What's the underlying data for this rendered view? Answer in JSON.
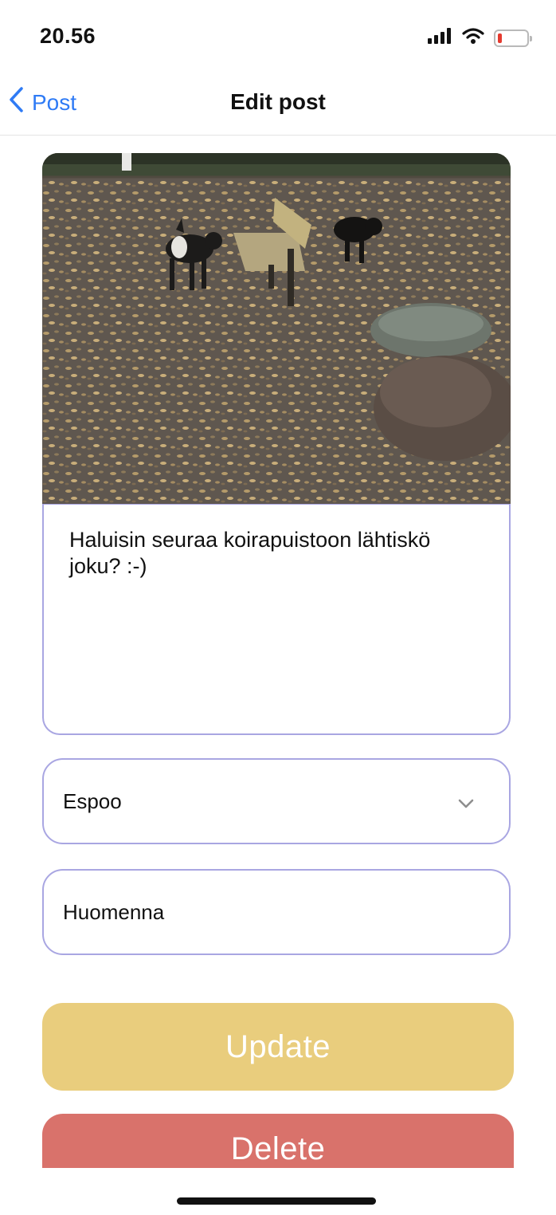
{
  "status_bar": {
    "time": "20.56",
    "icons": [
      "signal-icon",
      "wifi-icon",
      "battery-icon"
    ],
    "battery_color": "#e53a2f"
  },
  "nav": {
    "back_label": "Post",
    "title": "Edit post",
    "accent_color": "#2f7bf5"
  },
  "post": {
    "image_alt": "photo of dogs in park",
    "text": "Haluisin seuraa koirapuistoon lähtiskö joku? :-)",
    "location_value": "Espoo",
    "date_value": "Huomenna"
  },
  "actions": {
    "update_label": "Update",
    "delete_label": "Delete",
    "update_color": "#e9cd7d",
    "delete_color": "#d9726b"
  },
  "colors": {
    "field_border": "#a9a6e2"
  }
}
